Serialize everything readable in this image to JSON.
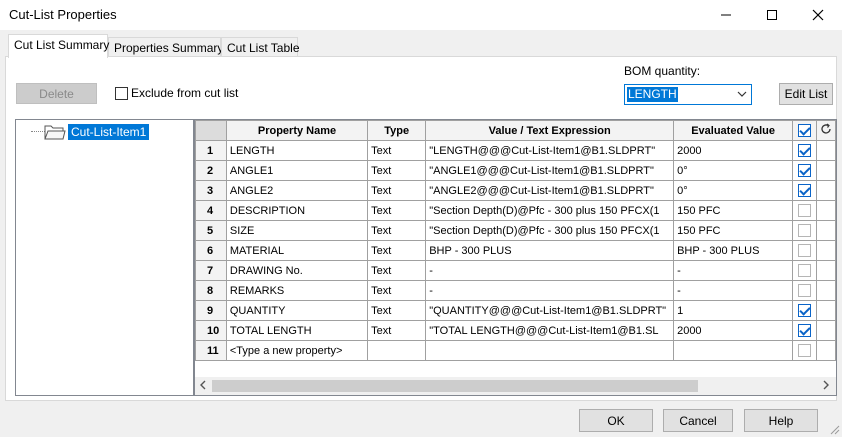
{
  "window": {
    "title": "Cut-List Properties"
  },
  "tabs": [
    {
      "label": "Cut List Summary",
      "active": true
    },
    {
      "label": "Properties Summary",
      "active": false
    },
    {
      "label": "Cut List Table",
      "active": false
    }
  ],
  "toolbar": {
    "delete_label": "Delete",
    "exclude_label": "Exclude from cut list",
    "bom_quantity_label": "BOM quantity:",
    "bom_quantity_value": "LENGTH",
    "edit_list_label": "Edit List"
  },
  "tree": {
    "item_label": "Cut-List-Item1"
  },
  "grid": {
    "columns": [
      "Property Name",
      "Type",
      "Value / Text Expression",
      "Evaluated Value"
    ],
    "rows": [
      {
        "num": "1",
        "name": "LENGTH",
        "type": "Text",
        "expr": "\"LENGTH@@@Cut-List-Item1@B1.SLDPRT\"",
        "value": "2000",
        "checked": true
      },
      {
        "num": "2",
        "name": "ANGLE1",
        "type": "Text",
        "expr": "\"ANGLE1@@@Cut-List-Item1@B1.SLDPRT\"",
        "value": "0°",
        "checked": true
      },
      {
        "num": "3",
        "name": "ANGLE2",
        "type": "Text",
        "expr": "\"ANGLE2@@@Cut-List-Item1@B1.SLDPRT\"",
        "value": "0°",
        "checked": true
      },
      {
        "num": "4",
        "name": "DESCRIPTION",
        "type": "Text",
        "expr": "\"Section Depth(D)@Pfc - 300 plus 150 PFCX(1",
        "value": "150 PFC",
        "checked": false
      },
      {
        "num": "5",
        "name": "SIZE",
        "type": "Text",
        "expr": "\"Section Depth(D)@Pfc - 300 plus 150 PFCX(1",
        "value": "150 PFC",
        "checked": false
      },
      {
        "num": "6",
        "name": "MATERIAL",
        "type": "Text",
        "expr": "BHP - 300 PLUS",
        "value": "BHP - 300 PLUS",
        "checked": false
      },
      {
        "num": "7",
        "name": "DRAWING No.",
        "type": "Text",
        "expr": "-",
        "value": "-",
        "checked": false
      },
      {
        "num": "8",
        "name": "REMARKS",
        "type": "Text",
        "expr": "-",
        "value": "-",
        "checked": false
      },
      {
        "num": "9",
        "name": "QUANTITY",
        "type": "Text",
        "expr": "\"QUANTITY@@@Cut-List-Item1@B1.SLDPRT\"",
        "value": "1",
        "checked": true
      },
      {
        "num": "10",
        "name": "TOTAL LENGTH",
        "type": "Text",
        "expr": "\"TOTAL LENGTH@@@Cut-List-Item1@B1.SL",
        "value": "2000",
        "checked": true
      },
      {
        "num": "11",
        "name": "<Type a new property>",
        "type": "",
        "expr": "",
        "value": "",
        "checked": false
      }
    ]
  },
  "footer": {
    "ok_label": "OK",
    "cancel_label": "Cancel",
    "help_label": "Help"
  },
  "colors": {
    "accent": "#0078d7",
    "check": "#0a64c8"
  }
}
